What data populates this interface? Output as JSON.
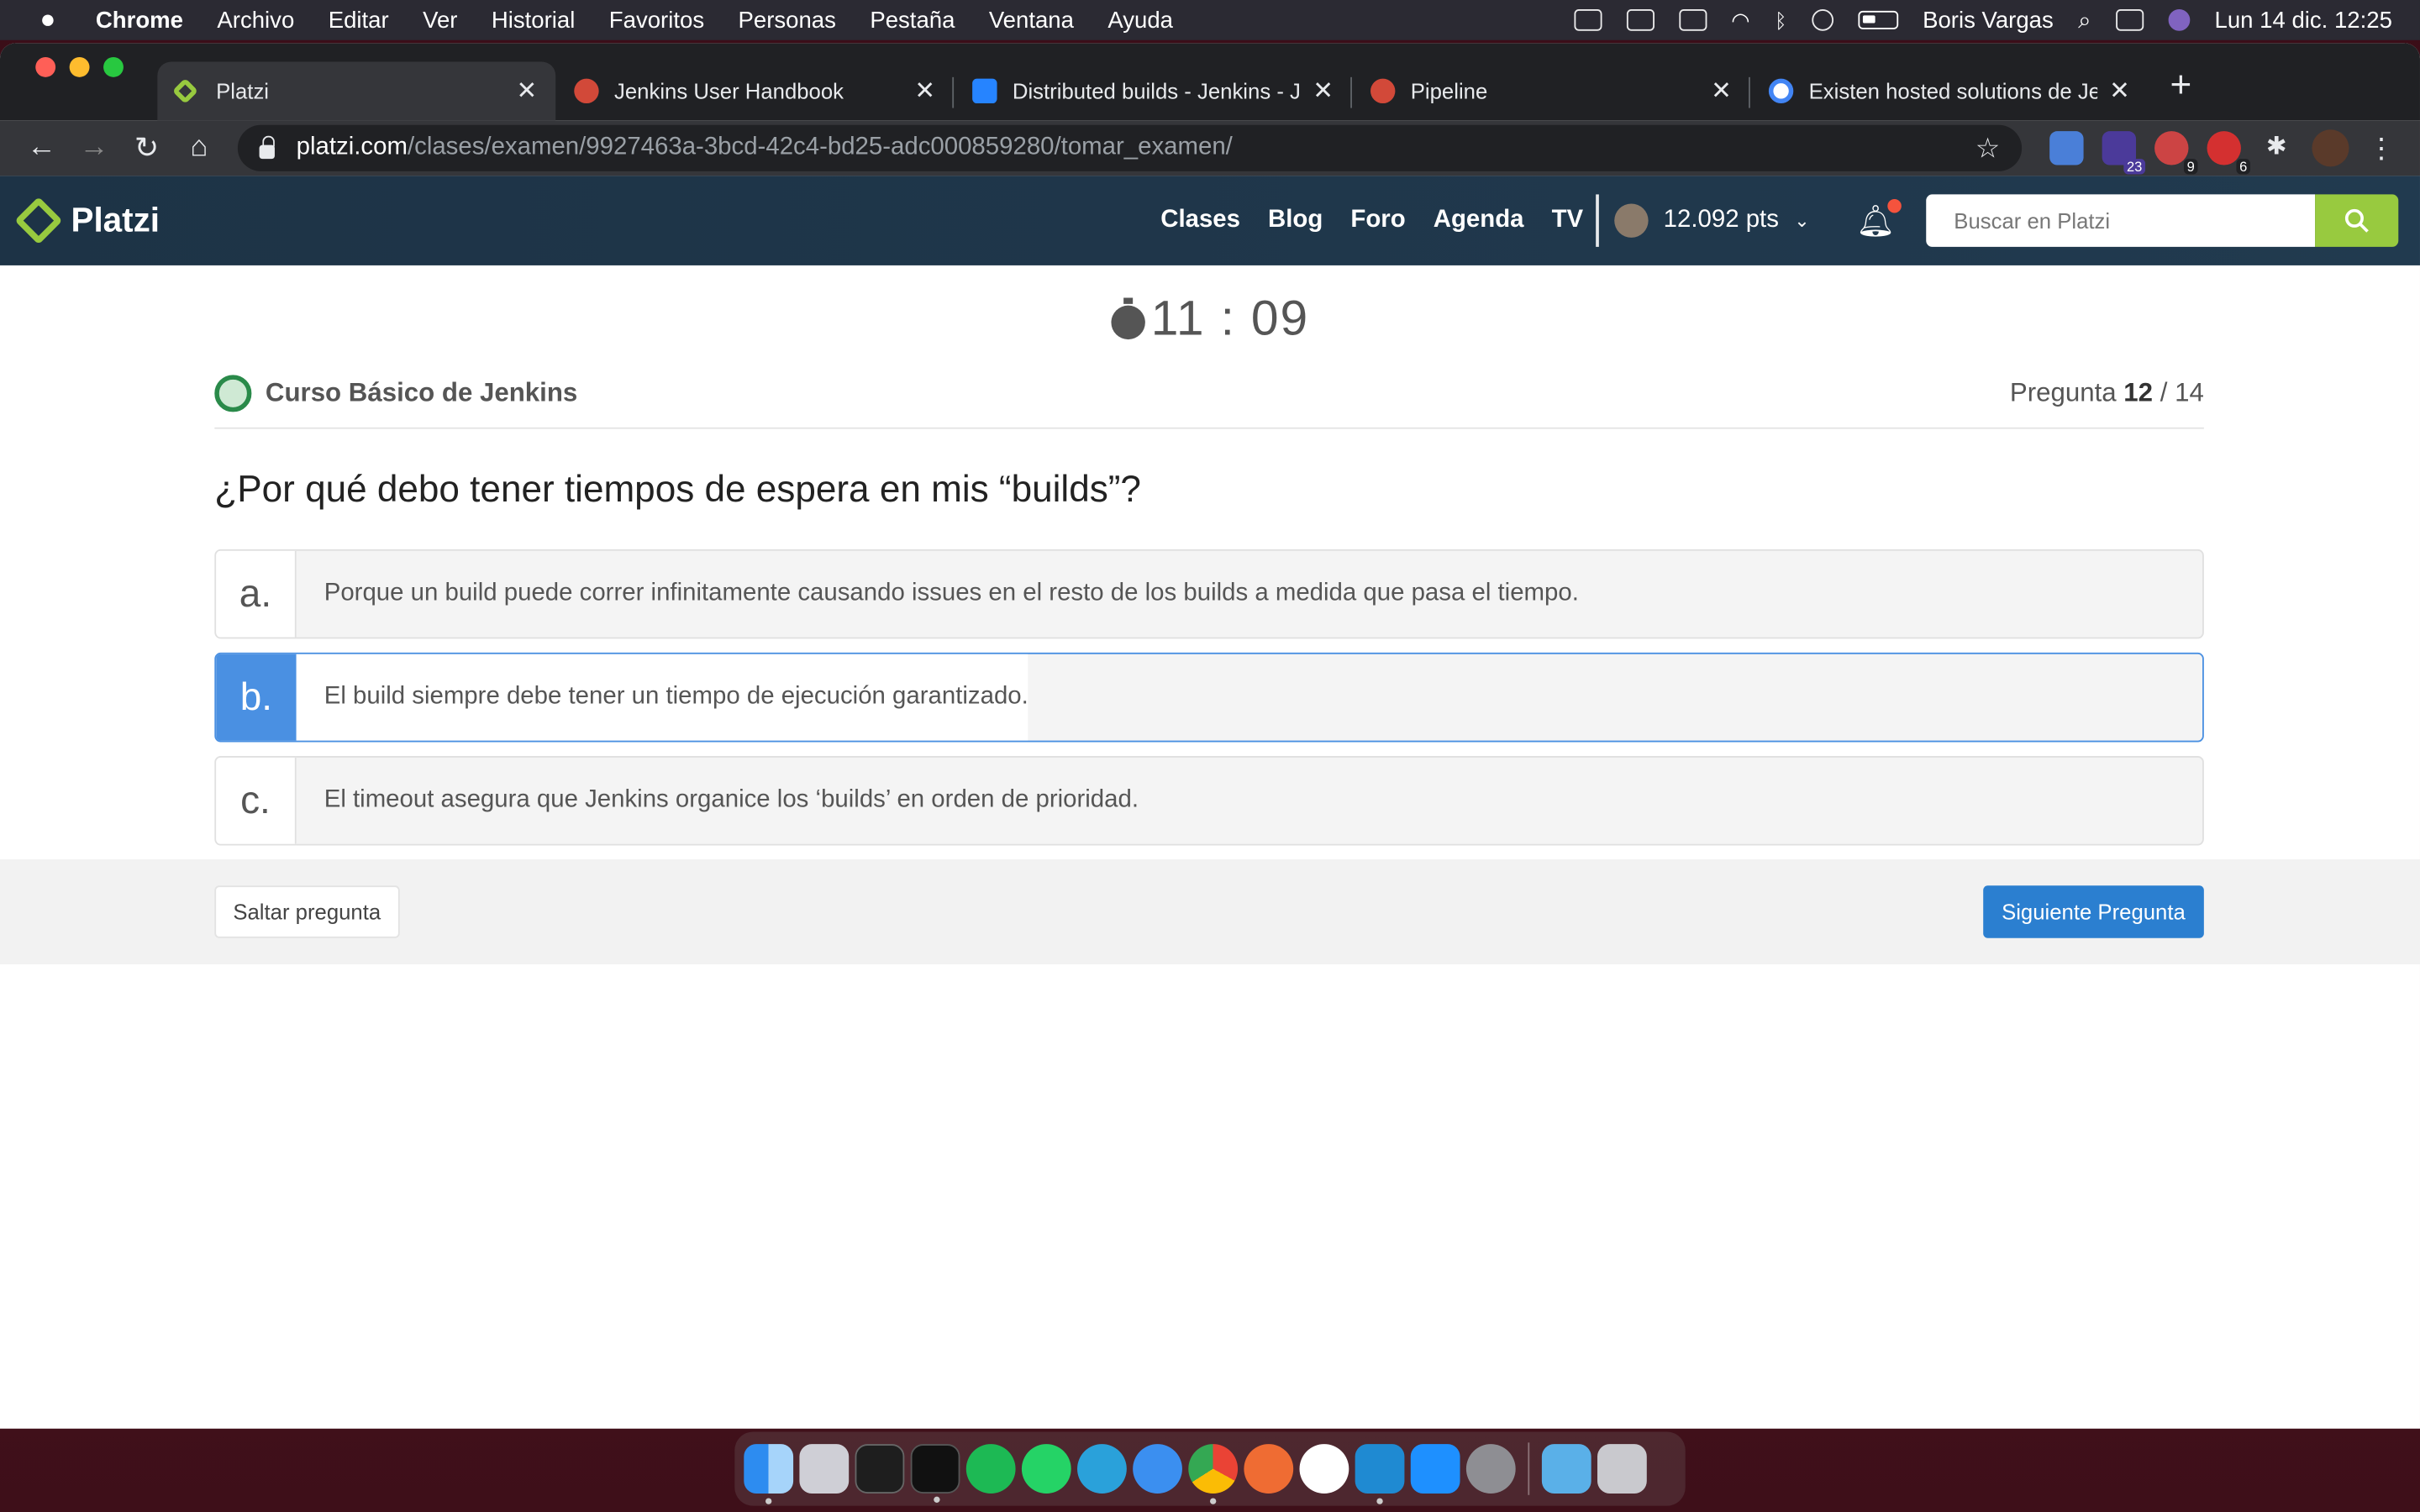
{
  "menubar": {
    "items": [
      "Chrome",
      "Archivo",
      "Editar",
      "Ver",
      "Historial",
      "Favoritos",
      "Personas",
      "Pestaña",
      "Ventana",
      "Ayuda"
    ],
    "user": "Boris Vargas",
    "datetime": "Lun 14 dic.  12:25"
  },
  "tabs": [
    {
      "title": "Platzi",
      "active": true
    },
    {
      "title": "Jenkins User Handbook",
      "active": false
    },
    {
      "title": "Distributed builds - Jenkins - J",
      "active": false
    },
    {
      "title": "Pipeline",
      "active": false
    },
    {
      "title": "Existen hosted solutions de Je",
      "active": false
    }
  ],
  "address": {
    "host": "platzi.com",
    "path": "/clases/examen/9927463a-3bcd-42c4-bd25-adc000859280/tomar_examen/"
  },
  "extensions": {
    "badge1": "23",
    "badge2": "9",
    "badge3": "6"
  },
  "header": {
    "logo": "Platzi",
    "nav": [
      "Clases",
      "Blog",
      "Foro",
      "Agenda",
      "TV"
    ],
    "points": "12.092 pts",
    "search_placeholder": "Buscar en Platzi"
  },
  "exam": {
    "timer": "11 : 09",
    "course": "Curso Básico de Jenkins",
    "question_label": "Pregunta",
    "question_current": "12",
    "question_total": "/ 14",
    "question": "¿Por qué debo tener tiempos de espera en mis “builds”?",
    "answers": [
      {
        "letter": "a.",
        "text": "Porque un build puede correr infinitamente causando issues en el resto de los builds a medida que pasa el tiempo.",
        "selected": false
      },
      {
        "letter": "b.",
        "text": "El build siempre debe tener un tiempo de ejecución garantizado.",
        "selected": true
      },
      {
        "letter": "c.",
        "text": "El timeout asegura que Jenkins organice los ‘builds’ en orden de prioridad.",
        "selected": false
      }
    ],
    "skip_label": "Saltar pregunta",
    "next_label": "Siguiente Pregunta"
  },
  "colors": {
    "accent": "#98ca3f",
    "selected": "#4a90e2",
    "primary_button": "#2b7fd0",
    "header": "#1d3346"
  }
}
